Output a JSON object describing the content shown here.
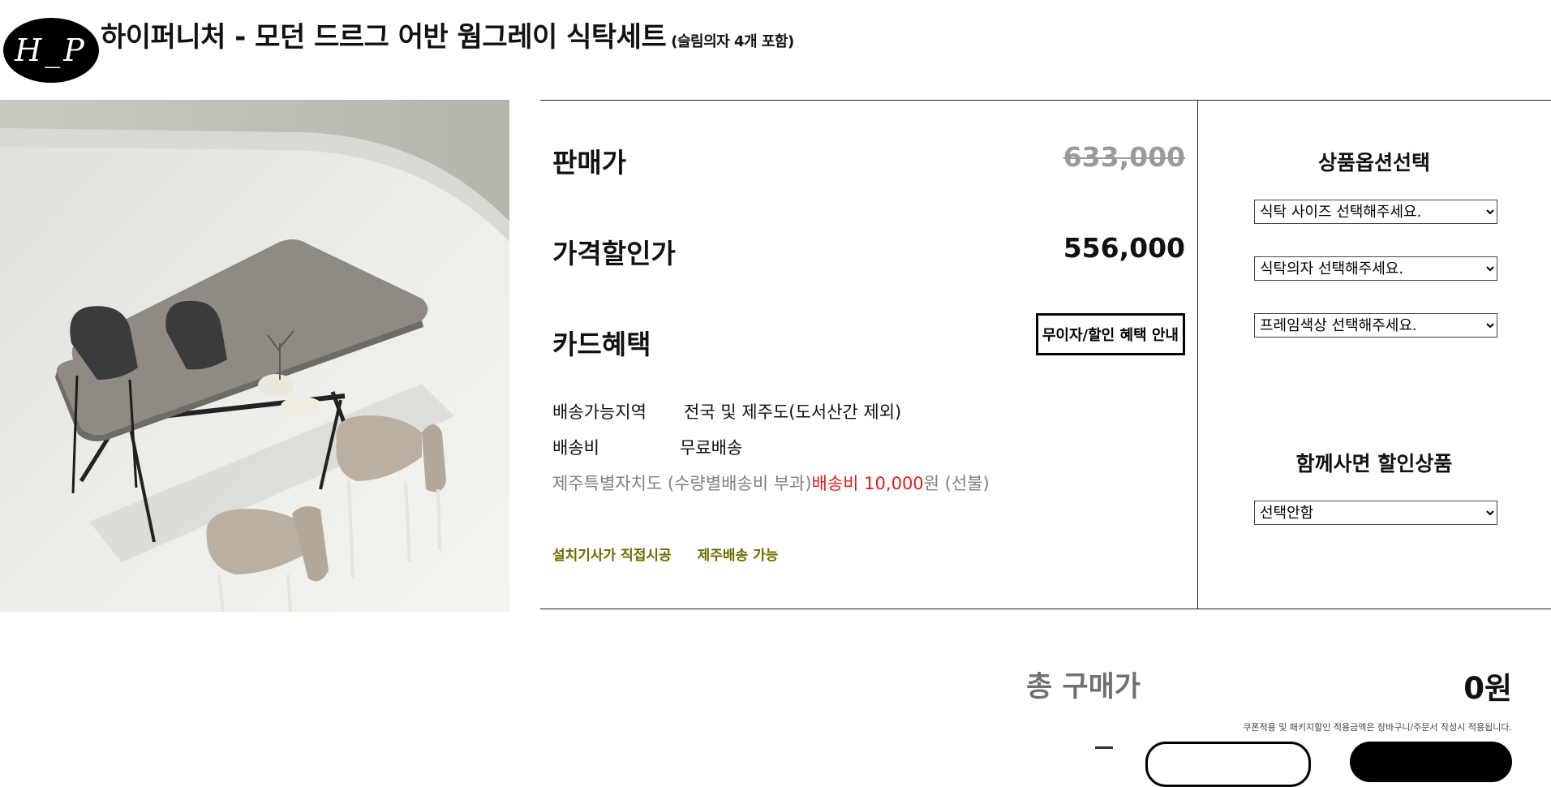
{
  "header": {
    "logo_text": "H_P",
    "title": "하이퍼니처 - 모던 드르그 어반 웜그레이 식탁세트",
    "subtitle": "(슬림의자 4개 포함)"
  },
  "pricing": {
    "sale_price_label": "판매가",
    "sale_price_value": "633,000",
    "discount_price_label": "가격할인가",
    "discount_price_value": "556,000",
    "card_benefit_label": "카드혜택",
    "card_benefit_button": "무이자/할인 혜택 안내"
  },
  "shipping": {
    "area_label": "배송가능지역",
    "area_value": "전국 및 제주도(도서산간 제외)",
    "fee_label": "배송비",
    "fee_value": "무료배송",
    "jeju_note_prefix": "제주특별자치도 (수량별배송비 부과)",
    "jeju_note_highlight": "배송비 10,000",
    "jeju_note_suffix": "원 (선불)"
  },
  "tags": [
    "설치기사가 직접시공",
    "제주배송 가능"
  ],
  "options": {
    "title": "상품옵션선택",
    "table_size": "식탁 사이즈 선택해주세요.",
    "chair": "식탁의자 선택해주세요.",
    "frame_color": "프레임색상 선택해주세요."
  },
  "bundle": {
    "title": "함께사면 할인상품",
    "selected": "선택안함"
  },
  "total": {
    "label": "총 구매가",
    "value": "0원",
    "note": "쿠폰적용 및 패키지할인 적용금액은 장바구니/주문서 작성시 적용됩니다."
  },
  "colors": {
    "accent_red": "#e01c1c",
    "tag_olive": "#6a6a00",
    "strike_gray": "#9a9a9a"
  }
}
